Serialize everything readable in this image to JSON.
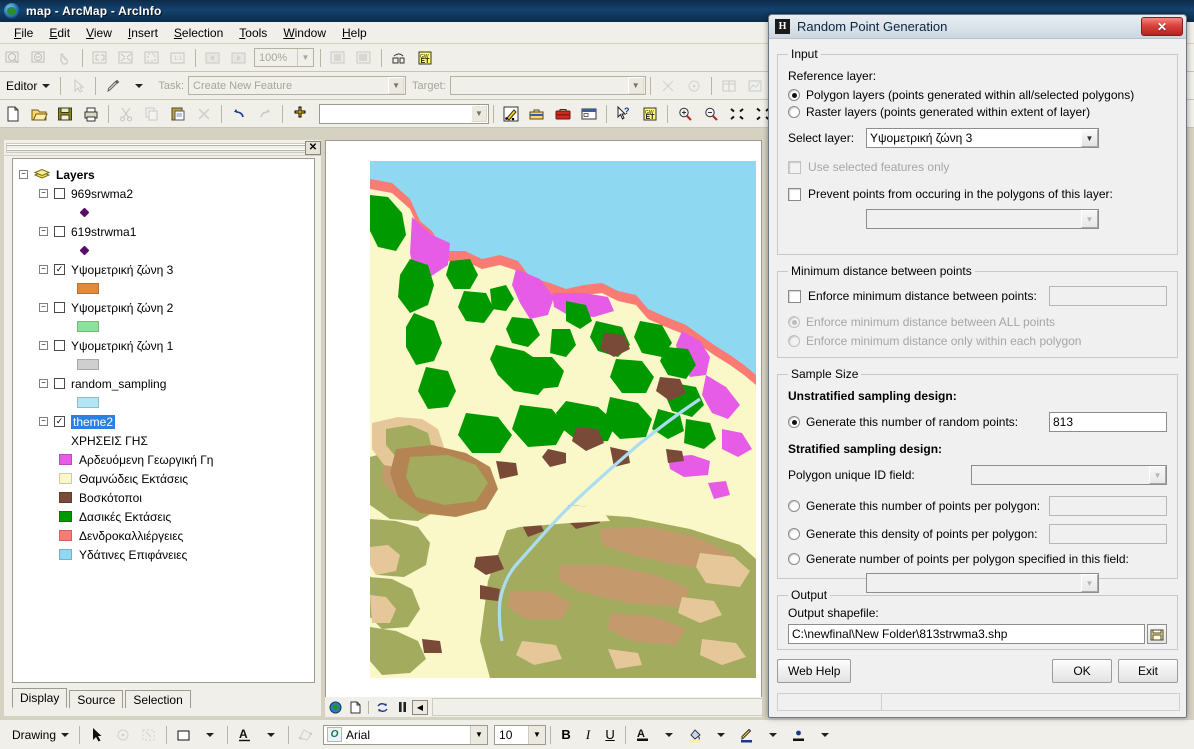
{
  "window": {
    "title": "map - ArcMap - ArcInfo",
    "app_icon": "arcmap-globe-icon"
  },
  "menu": {
    "items": [
      "File",
      "Edit",
      "View",
      "Insert",
      "Selection",
      "Tools",
      "Window",
      "Help"
    ]
  },
  "toolbars": {
    "standard_zoom_value": "100%",
    "editor": {
      "menu_label": "Editor",
      "task_label": "Task:",
      "task_value": "Create New Feature",
      "target_label": "Target:",
      "target_value": ""
    },
    "file_combo_value": ""
  },
  "toc": {
    "close_label": "✕",
    "root": {
      "label": "Layers",
      "icon": "layers-stack-icon"
    },
    "layers": [
      {
        "label": "969srwma2",
        "checked": false,
        "symbol_type": "point",
        "color": "#5b0b6b"
      },
      {
        "label": "619strwma1",
        "checked": false,
        "symbol_type": "point",
        "color": "#5b0b6b"
      },
      {
        "label": "Υψομετρική ζώνη 3",
        "checked": true,
        "symbol_type": "fill",
        "color": "#e08a3c"
      },
      {
        "label": "Υψομετρική ζώνη 2",
        "checked": false,
        "symbol_type": "fill",
        "color": "#8ce29a"
      },
      {
        "label": "Υψομετρική ζώνη 1",
        "checked": false,
        "symbol_type": "fill",
        "color": "#cfcfcf"
      },
      {
        "label": "random_sampling",
        "checked": false,
        "symbol_type": "fill",
        "color": "#b3e5f7"
      }
    ],
    "theme": {
      "label": "theme2",
      "checked": true,
      "selected": true,
      "heading": "ΧΡΗΣΕΙΣ ΓΗΣ",
      "classes": [
        {
          "label": "Αρδευόμενη Γεωργική Γη",
          "color": "#e75ce7"
        },
        {
          "label": "Θαμνώδεις Εκτάσεις",
          "color": "#faf7c8"
        },
        {
          "label": "Βοσκότοποι",
          "color": "#7a4a38"
        },
        {
          "label": "Δασικές Εκτάσεις",
          "color": "#009900"
        },
        {
          "label": "Δενδροκαλλιέργειες",
          "color": "#fa7b74"
        },
        {
          "label": "Υδάτινες Επιφάνειες",
          "color": "#8fd8f2"
        }
      ]
    },
    "tabs": [
      {
        "label": "Display",
        "active": true
      },
      {
        "label": "Source",
        "active": false
      },
      {
        "label": "Selection",
        "active": false
      }
    ]
  },
  "map": {
    "colors": {
      "water": "#8fd8f2",
      "scrub": "#faf7c8",
      "forest": "#009900",
      "pasture": "#7a4a38",
      "orchard": "#fa7b74",
      "irrigated": "#e75ce7",
      "olive": "#a3ab5e",
      "tan": "#e6c79a",
      "brown_mid": "#c49a6c",
      "river": "#aaddf2",
      "background": "#ffffff"
    }
  },
  "dialog": {
    "title": "Random Point Generation",
    "icon": "h-app-icon",
    "close_label": "✕",
    "input_group": {
      "legend": "Input",
      "reference_layer_label": "Reference layer:",
      "options": [
        {
          "label": "Polygon layers (points generated within all/selected polygons)",
          "selected": true
        },
        {
          "label": "Raster layers (points generated within extent of layer)",
          "selected": false
        }
      ],
      "select_layer_label": "Select layer:",
      "select_layer_value": "Υψομετρική ζώνη 3",
      "use_selected_label": "Use selected features only",
      "use_selected_checked": false,
      "use_selected_disabled": true,
      "prevent_label": "Prevent points from occuring in the polygons of this layer:",
      "prevent_checked": false,
      "prevent_value": ""
    },
    "min_distance_group": {
      "legend": "Minimum distance between points",
      "enforce_label": "Enforce minimum distance between points:",
      "enforce_checked": false,
      "enforce_value": "",
      "sub_options": [
        {
          "label": "Enforce minimum distance between ALL points",
          "selected": true,
          "disabled": true
        },
        {
          "label": "Enforce minimum distance only within each polygon",
          "selected": false,
          "disabled": true
        }
      ]
    },
    "sample_size_group": {
      "legend": "Sample Size",
      "unstratified_heading": "Unstratified sampling design:",
      "unstratified_option": {
        "label": "Generate this number of random points:",
        "selected": true,
        "value": "813"
      },
      "stratified_heading": "Stratified sampling design:",
      "polygon_id_label": "Polygon unique ID field:",
      "polygon_id_value": "",
      "stratified_options": [
        {
          "label": "Generate this number of points per polygon:",
          "selected": false,
          "value": ""
        },
        {
          "label": "Generate this density of points per polygon:",
          "selected": false,
          "value": ""
        },
        {
          "label": "Generate number of points per polygon specified in this field:",
          "selected": false,
          "value": ""
        }
      ]
    },
    "output_group": {
      "legend": "Output",
      "shapefile_label": "Output shapefile:",
      "shapefile_value": "C:\\newfinal\\New Folder\\813strwma3.shp",
      "browse_icon": "folder-icon"
    },
    "buttons": {
      "web_help": "Web Help",
      "ok": "OK",
      "exit": "Exit"
    }
  },
  "drawing_toolbar": {
    "menu_label": "Drawing",
    "font_name": "Arial",
    "font_size": "10",
    "bold": "B",
    "italic": "I",
    "underline": "U"
  }
}
